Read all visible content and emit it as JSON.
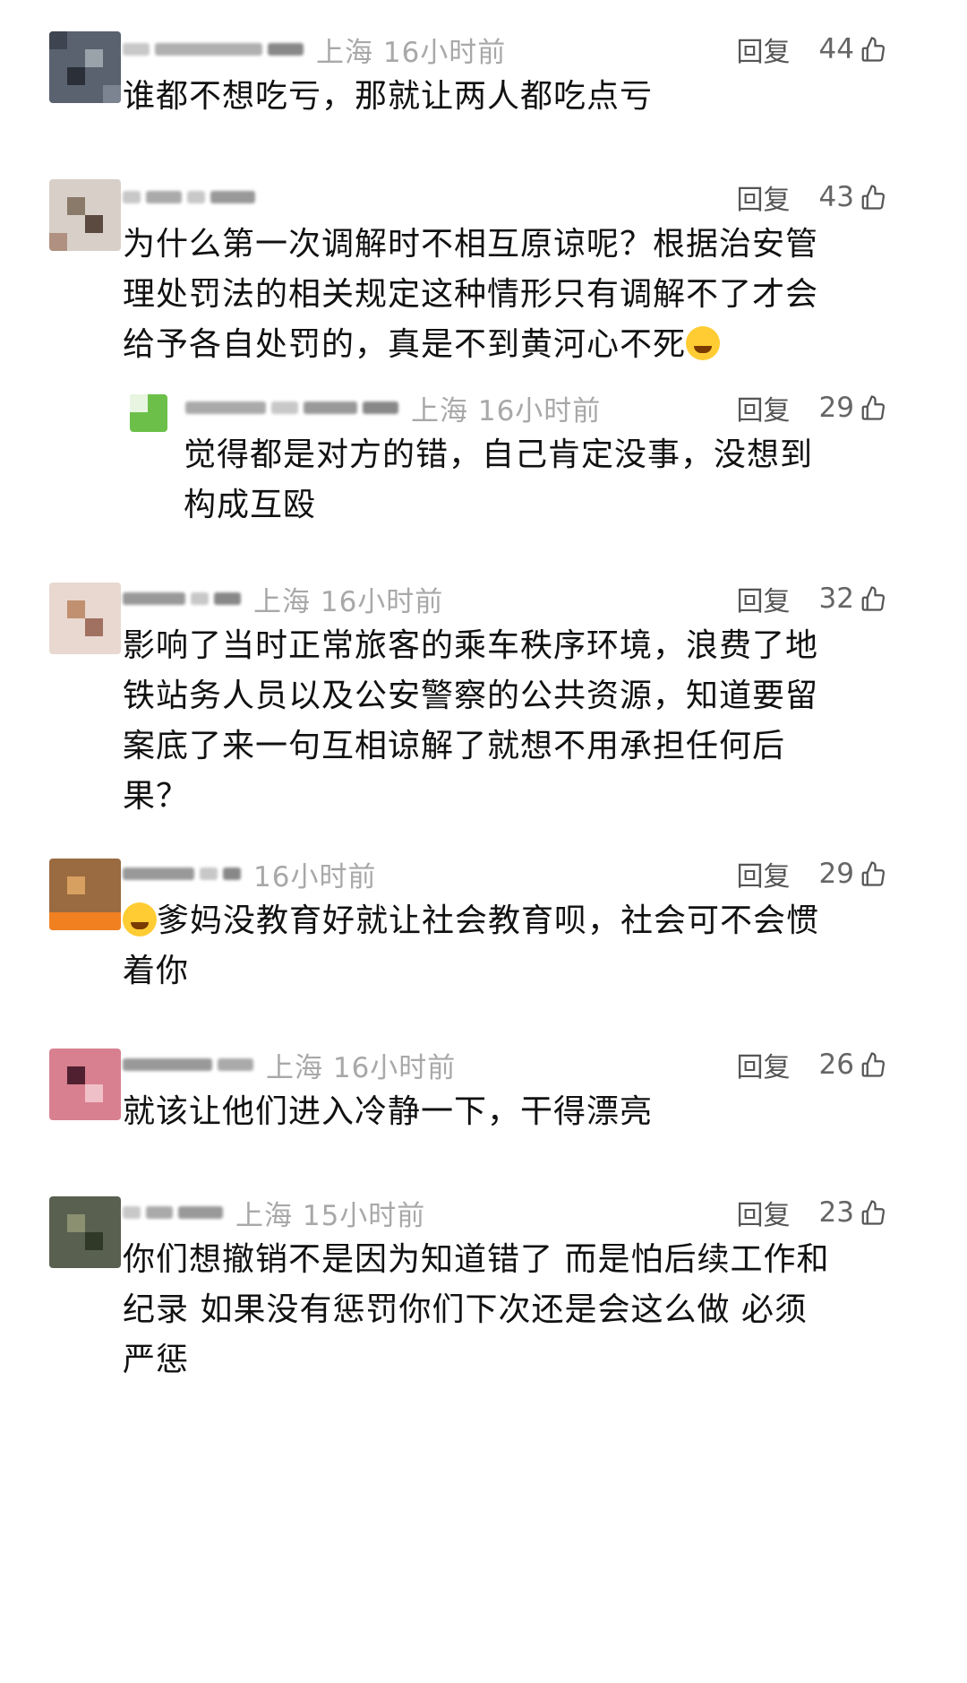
{
  "ui": {
    "reply_label": "回复"
  },
  "comments": [
    {
      "meta": "上海 16小时前",
      "likes": "44",
      "lines": [
        "谁都不想吃亏，那就让两人都吃点亏"
      ]
    },
    {
      "meta": "",
      "likes": "43",
      "lines": [
        "为什么第一次调解时不相互原谅呢？根据治安管",
        "理处罚法的相关规定这种情形只有调解不了才会",
        "给予各自处罚的，真是不到黄河心不死"
      ]
    },
    {
      "meta": "上海 16小时前",
      "likes": "29",
      "lines": [
        "觉得都是对方的错，自己肯定没事，没想到",
        "构成互殴"
      ]
    },
    {
      "meta": "上海 16小时前",
      "likes": "32",
      "lines": [
        "影响了当时正常旅客的乘车秩序环境，浪费了地",
        "铁站务人员以及公安警察的公共资源，知道要留",
        "案底了来一句互相谅解了就想不用承担任何后",
        "果？"
      ]
    },
    {
      "meta": "16小时前",
      "likes": "29",
      "lines": [
        "爹妈没教育好就让社会教育呗，社会可不会惯",
        "着你"
      ]
    },
    {
      "meta": "上海 16小时前",
      "likes": "26",
      "lines": [
        "就该让他们进入冷静一下，干得漂亮"
      ]
    },
    {
      "meta": "上海 15小时前",
      "likes": "23",
      "lines": [
        "你们想撤销不是因为知道错了 而是怕后续工作和",
        "纪录 如果没有惩罚你们下次还是会这么做 必须",
        "严惩"
      ]
    }
  ]
}
